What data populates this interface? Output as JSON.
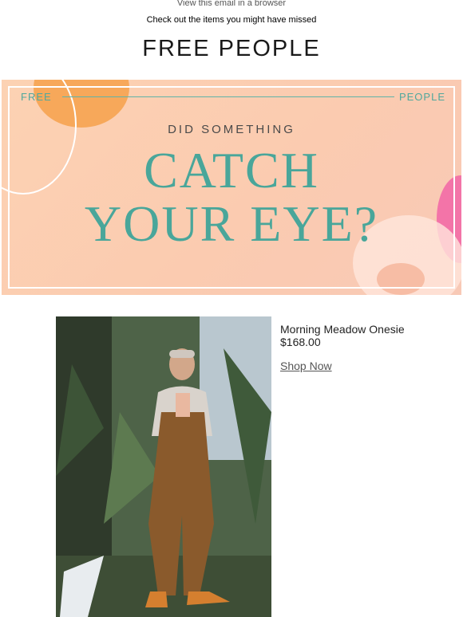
{
  "header": {
    "view_in_browser": "View this email in a browser",
    "preheader": "Check out the items you might have missed",
    "brand": "FREE PEOPLE"
  },
  "hero": {
    "label_left": "FREE",
    "label_right": "PEOPLE",
    "eyebrow": "DID SOMETHING",
    "headline_line1": "CATCH",
    "headline_line2": "YOUR EYE?",
    "colors": {
      "background": "#fbcbb0",
      "headline": "#49a69a",
      "frame": "#ffffff"
    }
  },
  "product": {
    "name": "Morning Meadow Onesie",
    "price": "$168.00",
    "cta": "Shop Now"
  }
}
